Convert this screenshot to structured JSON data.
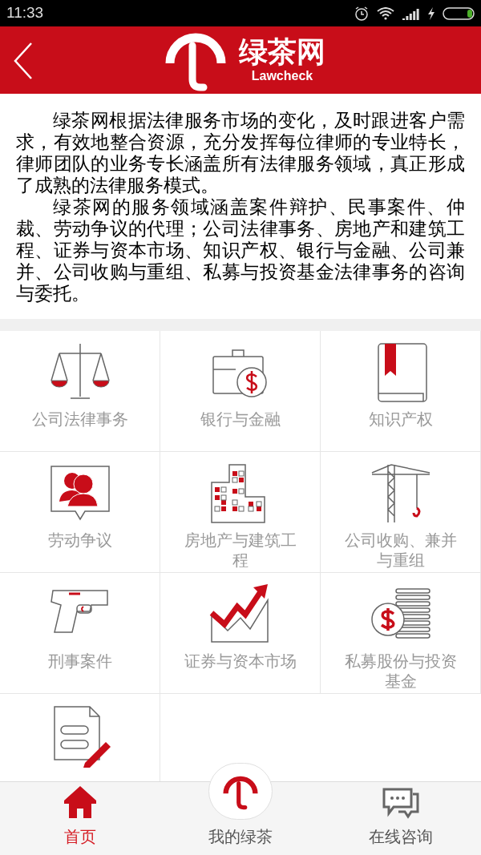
{
  "status_bar": {
    "time": "11:33"
  },
  "header": {
    "brand": "绿茶网",
    "brand_sub": "Lawcheck"
  },
  "intro": {
    "paragraphs": [
      "绿茶网根据法律服务市场的变化，及时跟进客户需求，有效地整合资源，充分发挥每位律师的专业特长，律师团队的业务专长涵盖所有法律服务领域，真正形成了成熟的法律服务模式。",
      "绿茶网的服务领域涵盖案件辩护、民事案件、仲裁、劳动争议的代理；公司法律事务、房地产和建筑工程、证券与资本市场、知识产权、银行与金融、公司兼并、公司收购与重组、私募与投资基金法律事务的咨询与委托。"
    ]
  },
  "services": [
    {
      "kind": "scales",
      "label": "公司法律事务"
    },
    {
      "kind": "briefcase",
      "label": "银行与金融"
    },
    {
      "kind": "book",
      "label": "知识产权"
    },
    {
      "kind": "people",
      "label": "劳动争议"
    },
    {
      "kind": "buildings",
      "label": "房地产与建筑工程"
    },
    {
      "kind": "crane",
      "label": "公司收购、兼并与重组"
    },
    {
      "kind": "pistol",
      "label": "刑事案件"
    },
    {
      "kind": "chart",
      "label": "证券与资本市场"
    },
    {
      "kind": "coins",
      "label": "私募股份与投资基金"
    },
    {
      "kind": "document"
    }
  ],
  "tab_bar": [
    {
      "kind": "home",
      "label": "首页",
      "selected": true
    },
    {
      "kind": "logo",
      "label": "我的绿茶",
      "selected": false
    },
    {
      "kind": "chat",
      "label": "在线咨询",
      "selected": false
    }
  ]
}
